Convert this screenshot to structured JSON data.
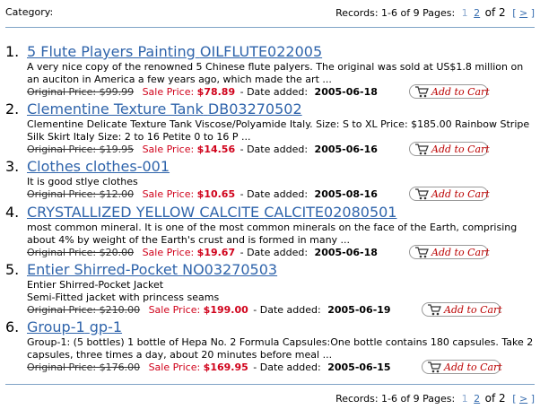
{
  "header": {
    "category_label": "Category:",
    "records": "Records: 1-6 of 9",
    "pages_label": "Pages:",
    "current_page": "1",
    "page_link": "2",
    "of_text": "of 2",
    "next_label": ">"
  },
  "footer": {
    "records": "Records: 1-6 of 9",
    "pages_label": "Pages:",
    "current_page": "1",
    "page_link": "2",
    "of_text": "of 2",
    "next_label": ">"
  },
  "cart_label": "Add to Cart",
  "products": [
    {
      "num": "1.",
      "name": "5 Flute Players Painting",
      "code": "OILFLUTE022005",
      "desc": "A very nice copy of the renowned 5 Chinese flute palyers. The original was sold at US$1.8 million on an auciton in America a few years ago, which made the art ...",
      "orig_price": "Original Price: $99.99",
      "sale_label": "Sale Price:",
      "sale_price": "$78.89",
      "date_label": "- Date added:",
      "date": "2005-06-18"
    },
    {
      "num": "2.",
      "name": "Clementine Texture Tank",
      "code": "DB03270502",
      "desc": "Clementine Delicate Texture Tank Viscose/Polyamide Italy. Size: S to XL Price: $185.00 Rainbow Stripe Silk Skirt Italy Size: 2 to 16 Petite 0 to 16 P ...",
      "orig_price": "Original Price: $19.95",
      "sale_label": "Sale Price:",
      "sale_price": "$14.56",
      "date_label": "- Date added:",
      "date": "2005-06-16"
    },
    {
      "num": "3.",
      "name": "Clothes",
      "code": "clothes-001",
      "desc": "It is good stlye clothes",
      "orig_price": "Original Price: $12.00",
      "sale_label": "Sale Price:",
      "sale_price": "$10.65",
      "date_label": "- Date added:",
      "date": "2005-08-16"
    },
    {
      "num": "4.",
      "name": "CRYSTALLIZED YELLOW CALCITE",
      "code": "CALCITE02080501",
      "desc": "most common mineral. It is one of the most common minerals on the face of the Earth, comprising about 4% by weight of the Earth's crust and is formed in many ...",
      "orig_price": "Original Price: $20.00",
      "sale_label": "Sale Price:",
      "sale_price": "$19.67",
      "date_label": "- Date added:",
      "date": "2005-06-18"
    },
    {
      "num": "5.",
      "name": "Entier Shirred-Pocket",
      "code": "NO03270503",
      "desc": "Entier Shirred-Pocket Jacket\nSemi-Fitted jacket with princess seams",
      "orig_price": "Original Price: $210.00",
      "sale_label": "Sale Price:",
      "sale_price": "$199.00",
      "date_label": "- Date added:",
      "date": "2005-06-19"
    },
    {
      "num": "6.",
      "name": "Group-1",
      "code": "gp-1",
      "desc": "Group-1: (5 bottles) 1 bottle of Hepa No. 2 Formula Capsules:One bottle contains 180 capsules. Take 2 capsules, three times a day, about 20 minutes before meal ...",
      "orig_price": "Original Price: $176.00",
      "sale_label": "Sale Price:",
      "sale_price": "$169.95",
      "date_label": "- Date added:",
      "date": "2005-06-15"
    }
  ]
}
